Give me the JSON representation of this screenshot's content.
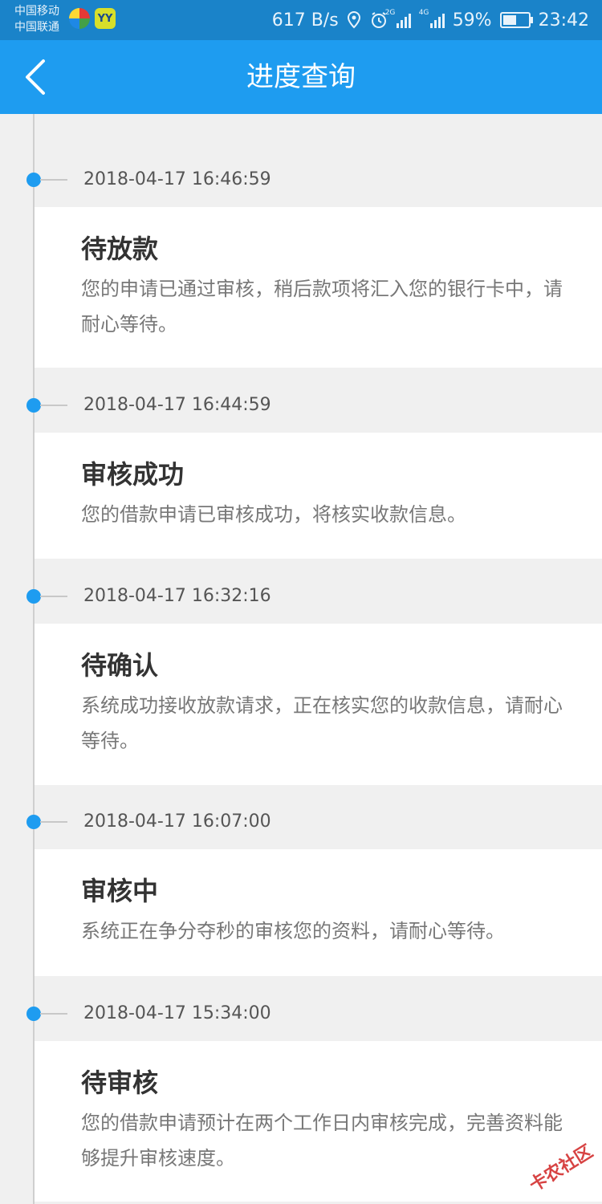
{
  "status_bar": {
    "carrier_1": "中国移动",
    "carrier_2": "中国联通",
    "app_icon_2_label": "YY",
    "speed": "617 B/s",
    "net_2g": "2G",
    "net_4g": "4G",
    "battery": "59%",
    "battery_level": 0.59,
    "time": "23:42"
  },
  "header": {
    "title": "进度查询"
  },
  "colors": {
    "accent": "#1e9cf0",
    "statusbar": "#1a83c9"
  },
  "timeline": [
    {
      "time": "2018-04-17 16:46:59",
      "status": "待放款",
      "desc": "您的申请已通过审核，稍后款项将汇入您的银行卡中，请耐心等待。"
    },
    {
      "time": "2018-04-17 16:44:59",
      "status": "审核成功",
      "desc": "您的借款申请已审核成功，将核实收款信息。"
    },
    {
      "time": "2018-04-17 16:32:16",
      "status": "待确认",
      "desc": "系统成功接收放款请求，正在核实您的收款信息，请耐心等待。"
    },
    {
      "time": "2018-04-17 16:07:00",
      "status": "审核中",
      "desc": "系统正在争分夺秒的审核您的资料，请耐心等待。"
    },
    {
      "time": "2018-04-17 15:34:00",
      "status": "待审核",
      "desc": "您的借款申请预计在两个工作日内审核完成，完善资料能够提升审核速度。"
    }
  ],
  "watermark": "卡农社区"
}
